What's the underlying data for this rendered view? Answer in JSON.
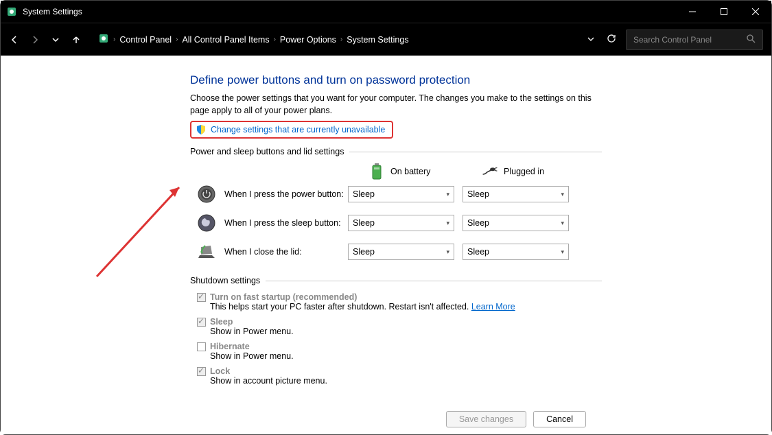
{
  "window": {
    "title": "System Settings"
  },
  "breadcrumb": {
    "items": [
      "Control Panel",
      "All Control Panel Items",
      "Power Options",
      "System Settings"
    ]
  },
  "search": {
    "placeholder": "Search Control Panel"
  },
  "page": {
    "heading": "Define power buttons and turn on password protection",
    "description": "Choose the power settings that you want for your computer. The changes you make to the settings on this page apply to all of your power plans.",
    "admin_link": "Change settings that are currently unavailable",
    "group1_label": "Power and sleep buttons and lid settings",
    "col_battery": "On battery",
    "col_plugged": "Plugged in",
    "rows": [
      {
        "label": "When I press the power button:",
        "battery": "Sleep",
        "plugged": "Sleep"
      },
      {
        "label": "When I press the sleep button:",
        "battery": "Sleep",
        "plugged": "Sleep"
      },
      {
        "label": "When I close the lid:",
        "battery": "Sleep",
        "plugged": "Sleep"
      }
    ],
    "group2_label": "Shutdown settings",
    "shutdown": [
      {
        "label": "Turn on fast startup (recommended)",
        "checked": true,
        "sub": "This helps start your PC faster after shutdown. Restart isn't affected.",
        "learn": "Learn More"
      },
      {
        "label": "Sleep",
        "checked": true,
        "sub": "Show in Power menu."
      },
      {
        "label": "Hibernate",
        "checked": false,
        "sub": "Show in Power menu."
      },
      {
        "label": "Lock",
        "checked": true,
        "sub": "Show in account picture menu."
      }
    ]
  },
  "footer": {
    "save": "Save changes",
    "cancel": "Cancel"
  }
}
